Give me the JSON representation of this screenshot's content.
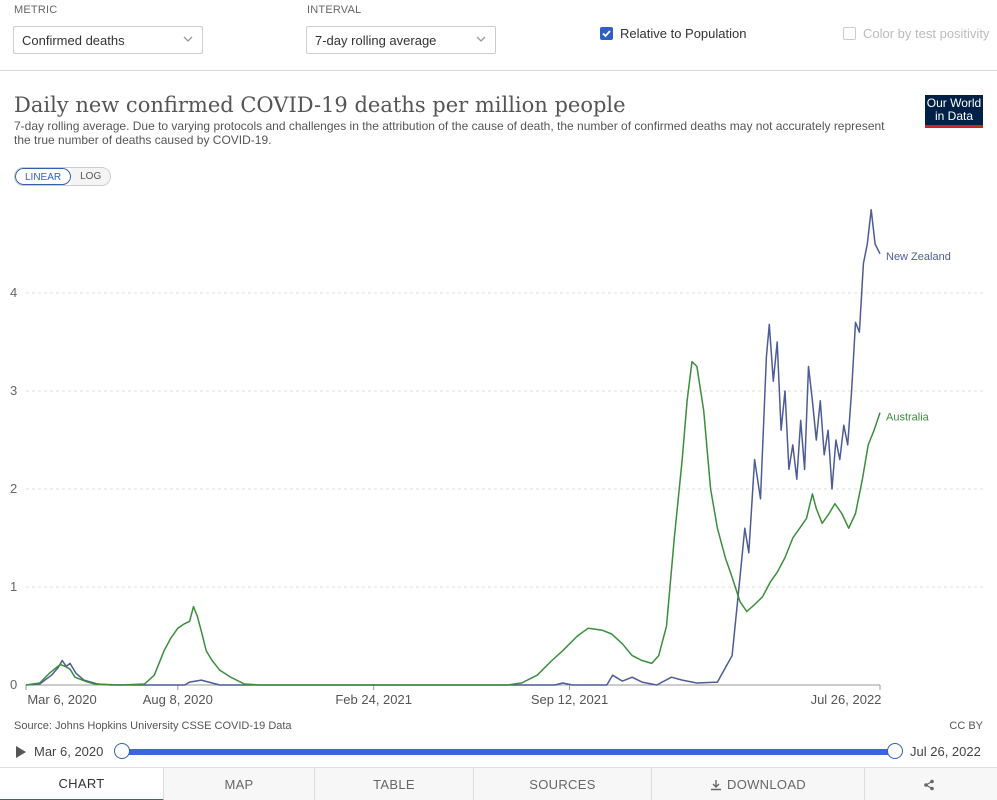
{
  "controls": {
    "metric_label": "METRIC",
    "metric_value": "Confirmed deaths",
    "interval_label": "INTERVAL",
    "interval_value": "7-day rolling average",
    "relative_label": "Relative to Population",
    "relative_checked": true,
    "positivity_label": "Color by test positivity",
    "positivity_checked": false
  },
  "header": {
    "title": "Daily new confirmed COVID-19 deaths per million people",
    "subtitle": "7-day rolling average. Due to varying protocols and challenges in the attribution of the cause of death, the number of confirmed deaths may not accurately represent the true number of deaths caused by COVID-19.",
    "logo_line1": "Our World",
    "logo_line2": "in Data",
    "scale_linear": "LINEAR",
    "scale_log": "LOG"
  },
  "chart_data": {
    "type": "line",
    "title": "Daily new confirmed COVID-19 deaths per million people",
    "xlabel": "",
    "ylabel": "",
    "x_start": "2020-03-06",
    "x_end": "2022-07-26",
    "x_ticks": [
      "Mar 6, 2020",
      "Aug 8, 2020",
      "Feb 24, 2021",
      "Sep 12, 2021",
      "Jul 26, 2022"
    ],
    "x_tick_dates": [
      "2020-03-06",
      "2020-08-08",
      "2021-02-24",
      "2021-09-12",
      "2022-07-26"
    ],
    "ylim": [
      0,
      4.9
    ],
    "y_ticks": [
      0,
      1,
      2,
      3,
      4
    ],
    "grid": "horizontal",
    "series": [
      {
        "name": "New Zealand",
        "color": "#4c5c96",
        "points": [
          [
            "2020-03-06",
            0
          ],
          [
            "2020-03-20",
            0.01
          ],
          [
            "2020-04-01",
            0.1
          ],
          [
            "2020-04-08",
            0.18
          ],
          [
            "2020-04-12",
            0.25
          ],
          [
            "2020-04-16",
            0.19
          ],
          [
            "2020-04-20",
            0.22
          ],
          [
            "2020-04-26",
            0.12
          ],
          [
            "2020-05-04",
            0.05
          ],
          [
            "2020-05-18",
            0.01
          ],
          [
            "2020-06-01",
            0
          ],
          [
            "2020-08-15",
            0
          ],
          [
            "2020-08-20",
            0.03
          ],
          [
            "2020-09-01",
            0.05
          ],
          [
            "2020-09-12",
            0.02
          ],
          [
            "2020-09-20",
            0
          ],
          [
            "2021-08-28",
            0
          ],
          [
            "2021-09-05",
            0.02
          ],
          [
            "2021-09-15",
            0
          ],
          [
            "2021-10-20",
            0
          ],
          [
            "2021-10-26",
            0.1
          ],
          [
            "2021-11-05",
            0.04
          ],
          [
            "2021-11-15",
            0.08
          ],
          [
            "2021-11-25",
            0.03
          ],
          [
            "2021-12-10",
            0
          ],
          [
            "2021-12-25",
            0.08
          ],
          [
            "2022-01-05",
            0.05
          ],
          [
            "2022-01-20",
            0.02
          ],
          [
            "2022-02-10",
            0.03
          ],
          [
            "2022-02-25",
            0.3
          ],
          [
            "2022-03-05",
            1.1
          ],
          [
            "2022-03-10",
            1.6
          ],
          [
            "2022-03-14",
            1.35
          ],
          [
            "2022-03-20",
            2.3
          ],
          [
            "2022-03-26",
            1.9
          ],
          [
            "2022-04-01",
            3.35
          ],
          [
            "2022-04-04",
            3.68
          ],
          [
            "2022-04-08",
            3.1
          ],
          [
            "2022-04-12",
            3.5
          ],
          [
            "2022-04-16",
            2.6
          ],
          [
            "2022-04-20",
            3.0
          ],
          [
            "2022-04-24",
            2.2
          ],
          [
            "2022-04-28",
            2.45
          ],
          [
            "2022-05-02",
            2.1
          ],
          [
            "2022-05-06",
            2.7
          ],
          [
            "2022-05-10",
            2.2
          ],
          [
            "2022-05-14",
            3.25
          ],
          [
            "2022-05-18",
            2.9
          ],
          [
            "2022-05-22",
            2.5
          ],
          [
            "2022-05-26",
            2.9
          ],
          [
            "2022-05-30",
            2.35
          ],
          [
            "2022-06-03",
            2.6
          ],
          [
            "2022-06-07",
            2.0
          ],
          [
            "2022-06-11",
            2.5
          ],
          [
            "2022-06-15",
            2.3
          ],
          [
            "2022-06-19",
            2.65
          ],
          [
            "2022-06-23",
            2.45
          ],
          [
            "2022-06-27",
            3.0
          ],
          [
            "2022-07-01",
            3.7
          ],
          [
            "2022-07-05",
            3.6
          ],
          [
            "2022-07-09",
            4.3
          ],
          [
            "2022-07-13",
            4.5
          ],
          [
            "2022-07-17",
            4.85
          ],
          [
            "2022-07-21",
            4.5
          ],
          [
            "2022-07-26",
            4.4
          ]
        ]
      },
      {
        "name": "Australia",
        "color": "#3b8e3b",
        "points": [
          [
            "2020-03-06",
            0
          ],
          [
            "2020-03-20",
            0.02
          ],
          [
            "2020-03-30",
            0.12
          ],
          [
            "2020-04-05",
            0.17
          ],
          [
            "2020-04-10",
            0.21
          ],
          [
            "2020-04-15",
            0.19
          ],
          [
            "2020-04-20",
            0.16
          ],
          [
            "2020-04-25",
            0.08
          ],
          [
            "2020-05-05",
            0.04
          ],
          [
            "2020-05-15",
            0.01
          ],
          [
            "2020-06-10",
            0
          ],
          [
            "2020-07-05",
            0.01
          ],
          [
            "2020-07-15",
            0.1
          ],
          [
            "2020-07-25",
            0.35
          ],
          [
            "2020-08-01",
            0.48
          ],
          [
            "2020-08-08",
            0.58
          ],
          [
            "2020-08-14",
            0.62
          ],
          [
            "2020-08-20",
            0.65
          ],
          [
            "2020-08-24",
            0.8
          ],
          [
            "2020-08-28",
            0.7
          ],
          [
            "2020-09-01",
            0.55
          ],
          [
            "2020-09-06",
            0.35
          ],
          [
            "2020-09-12",
            0.25
          ],
          [
            "2020-09-20",
            0.15
          ],
          [
            "2020-10-01",
            0.08
          ],
          [
            "2020-10-15",
            0.01
          ],
          [
            "2020-11-01",
            0
          ],
          [
            "2021-07-10",
            0
          ],
          [
            "2021-07-25",
            0.02
          ],
          [
            "2021-08-10",
            0.1
          ],
          [
            "2021-08-25",
            0.25
          ],
          [
            "2021-09-05",
            0.35
          ],
          [
            "2021-09-20",
            0.5
          ],
          [
            "2021-10-01",
            0.58
          ],
          [
            "2021-10-15",
            0.56
          ],
          [
            "2021-10-25",
            0.52
          ],
          [
            "2021-11-05",
            0.42
          ],
          [
            "2021-11-15",
            0.3
          ],
          [
            "2021-11-25",
            0.25
          ],
          [
            "2021-12-05",
            0.22
          ],
          [
            "2021-12-12",
            0.3
          ],
          [
            "2021-12-20",
            0.6
          ],
          [
            "2021-12-28",
            1.5
          ],
          [
            "2022-01-05",
            2.3
          ],
          [
            "2022-01-10",
            2.9
          ],
          [
            "2022-01-15",
            3.3
          ],
          [
            "2022-01-20",
            3.25
          ],
          [
            "2022-01-27",
            2.8
          ],
          [
            "2022-02-03",
            2.0
          ],
          [
            "2022-02-10",
            1.6
          ],
          [
            "2022-02-18",
            1.3
          ],
          [
            "2022-02-25",
            1.1
          ],
          [
            "2022-03-05",
            0.85
          ],
          [
            "2022-03-12",
            0.75
          ],
          [
            "2022-03-20",
            0.82
          ],
          [
            "2022-03-28",
            0.9
          ],
          [
            "2022-04-05",
            1.05
          ],
          [
            "2022-04-12",
            1.15
          ],
          [
            "2022-04-20",
            1.3
          ],
          [
            "2022-04-28",
            1.5
          ],
          [
            "2022-05-05",
            1.6
          ],
          [
            "2022-05-12",
            1.7
          ],
          [
            "2022-05-18",
            1.95
          ],
          [
            "2022-05-22",
            1.8
          ],
          [
            "2022-05-28",
            1.65
          ],
          [
            "2022-06-04",
            1.75
          ],
          [
            "2022-06-10",
            1.85
          ],
          [
            "2022-06-17",
            1.75
          ],
          [
            "2022-06-24",
            1.6
          ],
          [
            "2022-07-01",
            1.75
          ],
          [
            "2022-07-08",
            2.1
          ],
          [
            "2022-07-14",
            2.45
          ],
          [
            "2022-07-20",
            2.6
          ],
          [
            "2022-07-26",
            2.78
          ]
        ]
      }
    ]
  },
  "footer": {
    "source": "Source: Johns Hopkins University CSSE COVID-19 Data",
    "license": "CC BY"
  },
  "timeline": {
    "start": "Mar 6, 2020",
    "end": "Jul 26, 2022"
  },
  "tabs": {
    "chart": "CHART",
    "map": "MAP",
    "table": "TABLE",
    "sources": "SOURCES",
    "download": "DOWNLOAD"
  }
}
